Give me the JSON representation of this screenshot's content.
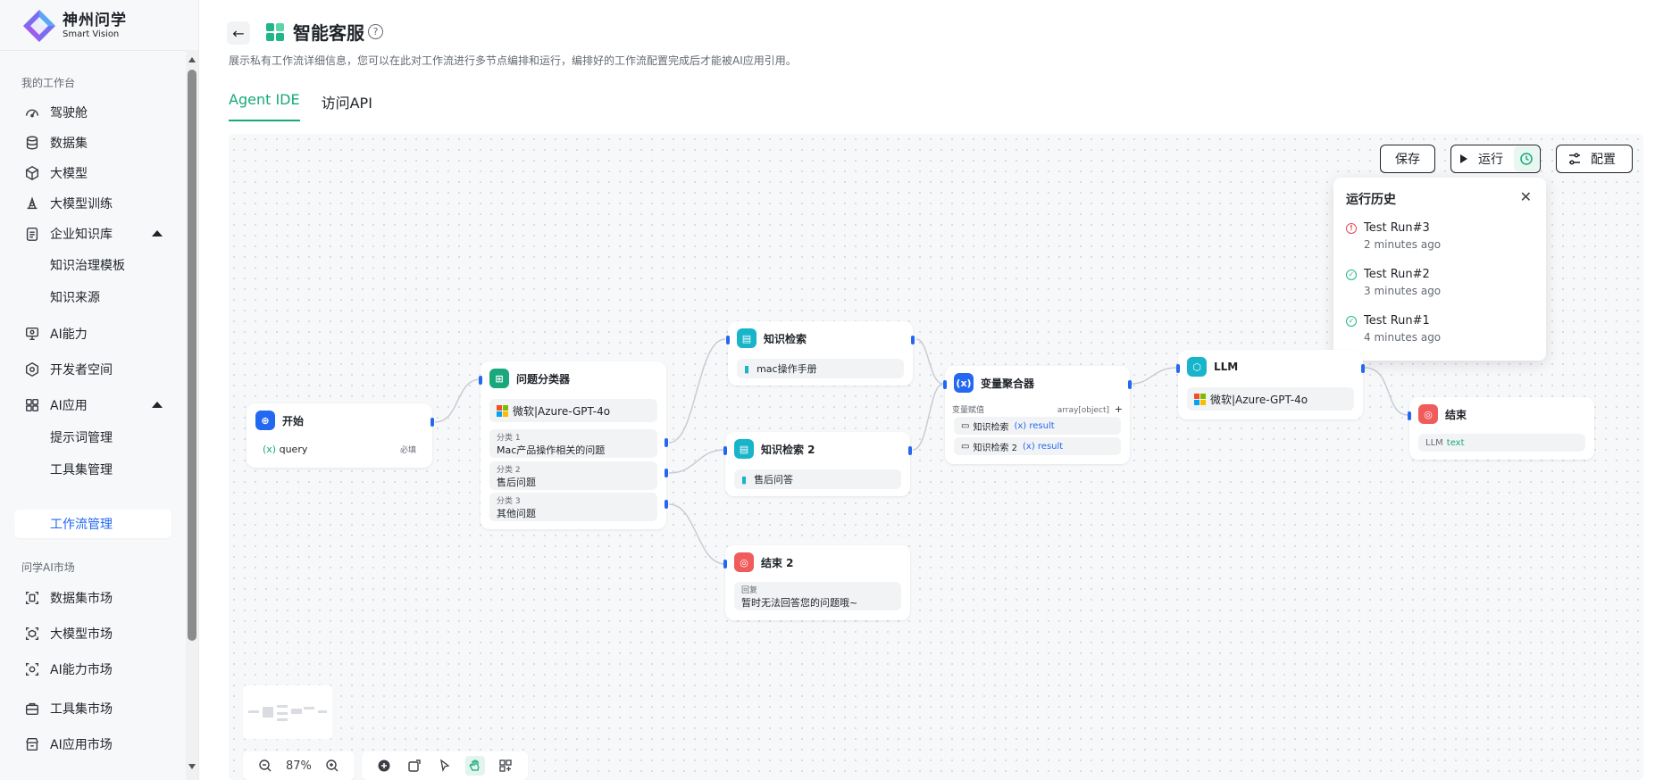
{
  "brand": {
    "title": "神州问学",
    "subtitle": "Smart Vision"
  },
  "sidebar": {
    "section1": "我的工作台",
    "items": [
      {
        "label": "驾驶舱",
        "icon": "dashboard-icon"
      },
      {
        "label": "数据集",
        "icon": "database-icon"
      },
      {
        "label": "大模型",
        "icon": "cube-icon"
      },
      {
        "label": "大模型训练",
        "icon": "training-icon"
      },
      {
        "label": "企业知识库",
        "icon": "clipboard-icon",
        "expanded": true
      },
      {
        "label": "知识治理模板",
        "sub": true
      },
      {
        "label": "知识来源",
        "sub": true
      },
      {
        "label": "AI能力",
        "icon": "monitor-icon"
      },
      {
        "label": "开发者空间",
        "icon": "hexagon-icon"
      },
      {
        "label": "AI应用",
        "icon": "apps-icon",
        "expanded": true
      },
      {
        "label": "提示词管理",
        "sub": true
      },
      {
        "label": "工具集管理",
        "sub": true
      },
      {
        "label": "工作流管理",
        "sub": true,
        "active": true
      }
    ],
    "section2": "问学AI市场",
    "market": [
      {
        "label": "数据集市场",
        "icon": "dataset-market-icon"
      },
      {
        "label": "大模型市场",
        "icon": "model-market-icon"
      },
      {
        "label": "AI能力市场",
        "icon": "ai-market-icon"
      },
      {
        "label": "工具集市场",
        "icon": "toolbox-market-icon"
      },
      {
        "label": "AI应用市场",
        "icon": "app-market-icon"
      }
    ]
  },
  "header": {
    "title": "智能客服",
    "help": "?",
    "description": "展示私有工作流详细信息，您可以在此对工作流进行多节点编排和运行，编排好的工作流配置完成后才能被AI应用引用。",
    "tabs": [
      "Agent IDE",
      "访问API"
    ]
  },
  "toolbar": {
    "save": "保存",
    "run": "运行",
    "config": "配置"
  },
  "history": {
    "title": "运行历史",
    "runs": [
      {
        "name": "Test Run#3",
        "time": "2 minutes ago",
        "status": "error"
      },
      {
        "name": "Test Run#2",
        "time": "3 minutes ago",
        "status": "success"
      },
      {
        "name": "Test Run#1",
        "time": "4 minutes ago",
        "status": "success"
      }
    ]
  },
  "nodes": {
    "start": {
      "title": "开始",
      "var": "query",
      "required": "必填"
    },
    "classifier": {
      "title": "问题分类器",
      "model": "微软|Azure-GPT-4o",
      "classes": [
        {
          "label": "分类 1",
          "value": "Mac产品操作相关的问题"
        },
        {
          "label": "分类 2",
          "value": "售后问题"
        },
        {
          "label": "分类 3",
          "value": "其他问题"
        }
      ]
    },
    "kb1": {
      "title": "知识检索",
      "source": "mac操作手册"
    },
    "kb2": {
      "title": "知识检索 2",
      "source": "售后问答"
    },
    "end2": {
      "title": "结束 2",
      "label": "回复",
      "value": "暂时无法回答您的问题哦~"
    },
    "agg": {
      "title": "变量聚合器",
      "label": "变量赋值",
      "type": "array[object]",
      "plus": "+",
      "rows": [
        {
          "src": "知识检索",
          "var": "result"
        },
        {
          "src": "知识检索 2",
          "var": "result"
        }
      ]
    },
    "llm": {
      "title": "LLM",
      "model": "微软|Azure-GPT-4o"
    },
    "end": {
      "title": "结束",
      "src": "LLM",
      "var": "text"
    }
  },
  "zoom": {
    "level": "87%"
  },
  "colors": {
    "accent": "#19a87b",
    "link": "#2468f2",
    "error": "#e5484d"
  }
}
